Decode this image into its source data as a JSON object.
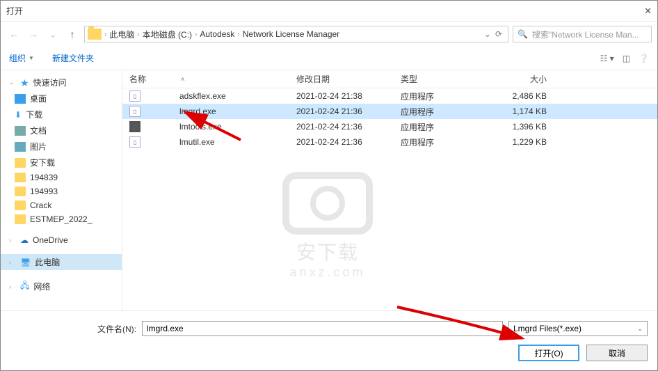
{
  "title": "打开",
  "breadcrumb": {
    "items": [
      "此电脑",
      "本地磁盘 (C:)",
      "Autodesk",
      "Network License Manager"
    ]
  },
  "search": {
    "placeholder": "搜索\"Network License Man..."
  },
  "toolbar": {
    "organize": "组织",
    "new_folder": "新建文件夹"
  },
  "sidebar": {
    "quick_access": "快速访问",
    "desktop": "桌面",
    "downloads": "下载",
    "documents": "文档",
    "pictures": "图片",
    "anxiazai": "安下载",
    "f194839": "194839",
    "f194993": "194993",
    "crack": "Crack",
    "estmep": "ESTMEP_2022_",
    "onedrive": "OneDrive",
    "this_pc": "此电脑",
    "network": "网络"
  },
  "columns": {
    "name": "名称",
    "date": "修改日期",
    "type": "类型",
    "size": "大小"
  },
  "files": [
    {
      "name": "adskflex.exe",
      "date": "2021-02-24 21:38",
      "type": "应用程序",
      "size": "2,486 KB",
      "selected": false
    },
    {
      "name": "lmgrd.exe",
      "date": "2021-02-24 21:36",
      "type": "应用程序",
      "size": "1,174 KB",
      "selected": true
    },
    {
      "name": "lmtools.exe",
      "date": "2021-02-24 21:36",
      "type": "应用程序",
      "size": "1,396 KB",
      "selected": false
    },
    {
      "name": "lmutil.exe",
      "date": "2021-02-24 21:36",
      "type": "应用程序",
      "size": "1,229 KB",
      "selected": false
    }
  ],
  "watermark": {
    "text": "安下载",
    "domain": "anxz.com"
  },
  "footer": {
    "filename_label": "文件名(N):",
    "filename_value": "lmgrd.exe",
    "filter": "Lmgrd Files(*.exe)",
    "open": "打开(O)",
    "cancel": "取消"
  }
}
